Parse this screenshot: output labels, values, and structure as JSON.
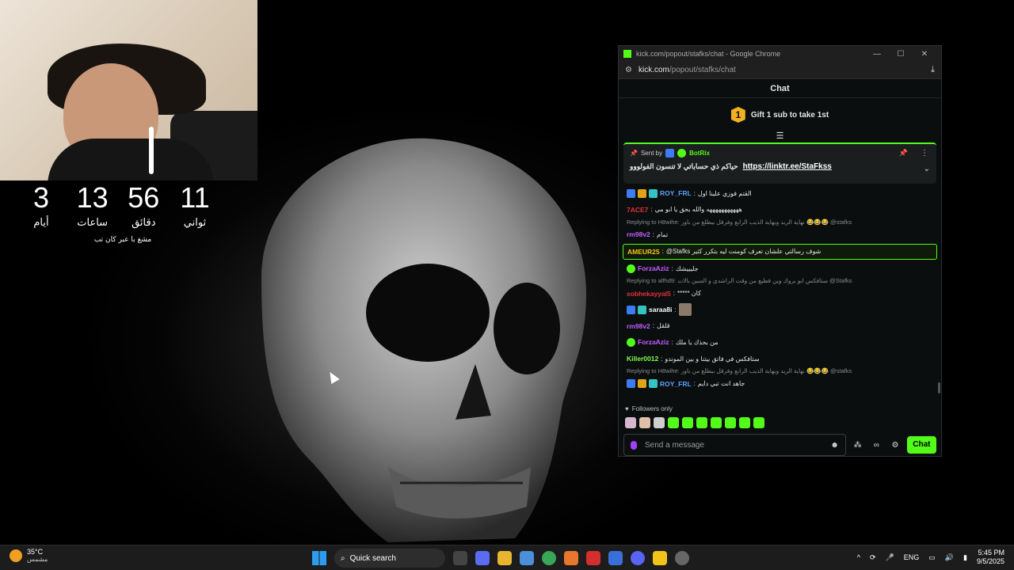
{
  "webcam": {},
  "countdown": {
    "units": [
      {
        "value": "3",
        "label": "أيام"
      },
      {
        "value": "13",
        "label": "ساعات"
      },
      {
        "value": "56",
        "label": "دقائق"
      },
      {
        "value": "11",
        "label": "ثواني"
      }
    ],
    "note": "مشغ با عبر كان تب"
  },
  "window": {
    "title": "kick.com/popout/stafks/chat - Google Chrome",
    "url_host": "kick.com",
    "url_path": "/popout/stafks/chat",
    "controls": {
      "minimize": "—",
      "maximize": "☐",
      "close": "✕"
    }
  },
  "chat": {
    "header": "Chat",
    "gift": {
      "badge": "1",
      "text": "Gift 1 sub to take 1st"
    },
    "pinned": {
      "sent_by": "Sent by",
      "bot": "BotRix",
      "text": "حياكم ذي حساباتي لا تنسون الفولووو",
      "link": "https://linktr.ee/StaFkss"
    },
    "messages": [
      {
        "type": "msg",
        "user": "ROY_FRL",
        "color": "#5aa0ff",
        "badges": [
          "blue",
          "gold",
          "teal"
        ],
        "text": "القتم فوزي علينا اول"
      },
      {
        "type": "msg",
        "user": "7ACE7",
        "color": "#e0303a",
        "badges": [],
        "text": "هههههههههههه والله بحق يا ابو مي"
      },
      {
        "type": "reply",
        "text": "Replying to H8wihe: نهاية الريد وبهاية الذيب الرابع وفرقل بيطلع من باور 😂😂😂 @stafks"
      },
      {
        "type": "msg",
        "user": "rm98v2",
        "color": "#c45cff",
        "badges": [],
        "text": "تمام"
      },
      {
        "type": "highlight",
        "user": "AMEUR25",
        "color": "#f0c419",
        "badges": [],
        "text": "@Stafks شوف رسالتي علشان تعرف كومنت ليه بتكرر كثير"
      },
      {
        "type": "msg",
        "user": "ForzaAziz",
        "color": "#c45cff",
        "badges": [
          "green"
        ],
        "text": "جليييشك"
      },
      {
        "type": "reply",
        "text": "Replying to alfhd9: ستافكس ابو بروك وين قطيع من وقت الراشدي و السين بالات @Stafks"
      },
      {
        "type": "msg",
        "user": "sobhekayyal5",
        "color": "#e0303a",
        "badges": [],
        "text": "***** كان"
      },
      {
        "type": "msg",
        "user": "saraa8i",
        "color": "#ffffff",
        "badges": [
          "blue",
          "teal"
        ],
        "text": "",
        "avatar": true
      },
      {
        "type": "msg",
        "user": "rm98v2",
        "color": "#c45cff",
        "badges": [],
        "text": "قلقل"
      },
      {
        "type": "msg",
        "user": "ForzaAziz",
        "color": "#c45cff",
        "badges": [
          "green"
        ],
        "text": "من بحذك يا ملك"
      },
      {
        "type": "msg",
        "user": "Killer0012",
        "color": "#7dff4a",
        "badges": [],
        "text": "ستافكس في فاتق بيتنا و بين الموندو"
      },
      {
        "type": "reply",
        "text": "Replying to H8wihe: نهاية الريد وبهاية الذيب الرابع وفرقل بيطلع من باور 😂😂😂 @stafks"
      },
      {
        "type": "msg",
        "user": "ROY_FRL",
        "color": "#5aa0ff",
        "badges": [
          "blue",
          "gold",
          "teal"
        ],
        "text": "جاهد انت تبي دايم"
      }
    ],
    "followers_only": "Followers only",
    "input_placeholder": "Send a message",
    "send_label": "Chat",
    "accent": "#53fc18"
  },
  "taskbar": {
    "temperature": "35°C",
    "condition": "مشمس",
    "search_label": "Quick search",
    "language": "ENG",
    "time": "5:45 PM",
    "date": "9/5/2025"
  }
}
